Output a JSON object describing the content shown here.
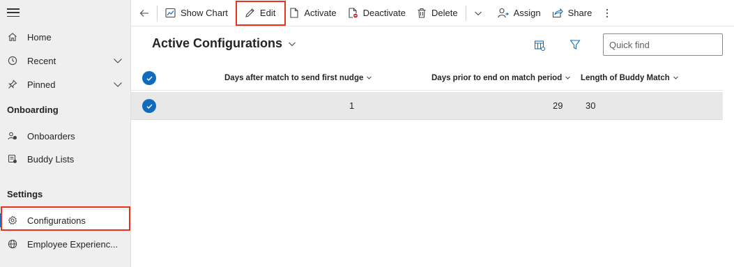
{
  "sidebar": {
    "items": [
      {
        "label": "Home",
        "icon": "home-icon"
      },
      {
        "label": "Recent",
        "icon": "clock-icon"
      },
      {
        "label": "Pinned",
        "icon": "pin-icon"
      }
    ],
    "sections": [
      {
        "title": "Onboarding",
        "items": [
          {
            "label": "Onboarders",
            "icon": "people-icon"
          },
          {
            "label": "Buddy Lists",
            "icon": "list-icon"
          }
        ]
      },
      {
        "title": "Settings",
        "items": [
          {
            "label": "Configurations",
            "icon": "gear-icon"
          },
          {
            "label": "Employee Experienc...",
            "icon": "globe-icon"
          }
        ]
      }
    ]
  },
  "toolbar": {
    "show_chart": "Show Chart",
    "edit": "Edit",
    "activate": "Activate",
    "deactivate": "Deactivate",
    "delete": "Delete",
    "assign": "Assign",
    "share": "Share"
  },
  "view": {
    "title": "Active Configurations",
    "quick_find_placeholder": "Quick find"
  },
  "grid": {
    "columns": [
      "Days after match to send first nudge",
      "Days prior to end on match period",
      "Length of Buddy Match"
    ],
    "rows": [
      [
        "1",
        "29",
        "30"
      ]
    ]
  },
  "colors": {
    "accent": "#0f6cbd",
    "highlight": "#e8321e",
    "selected_row": "#e8e8e8"
  }
}
